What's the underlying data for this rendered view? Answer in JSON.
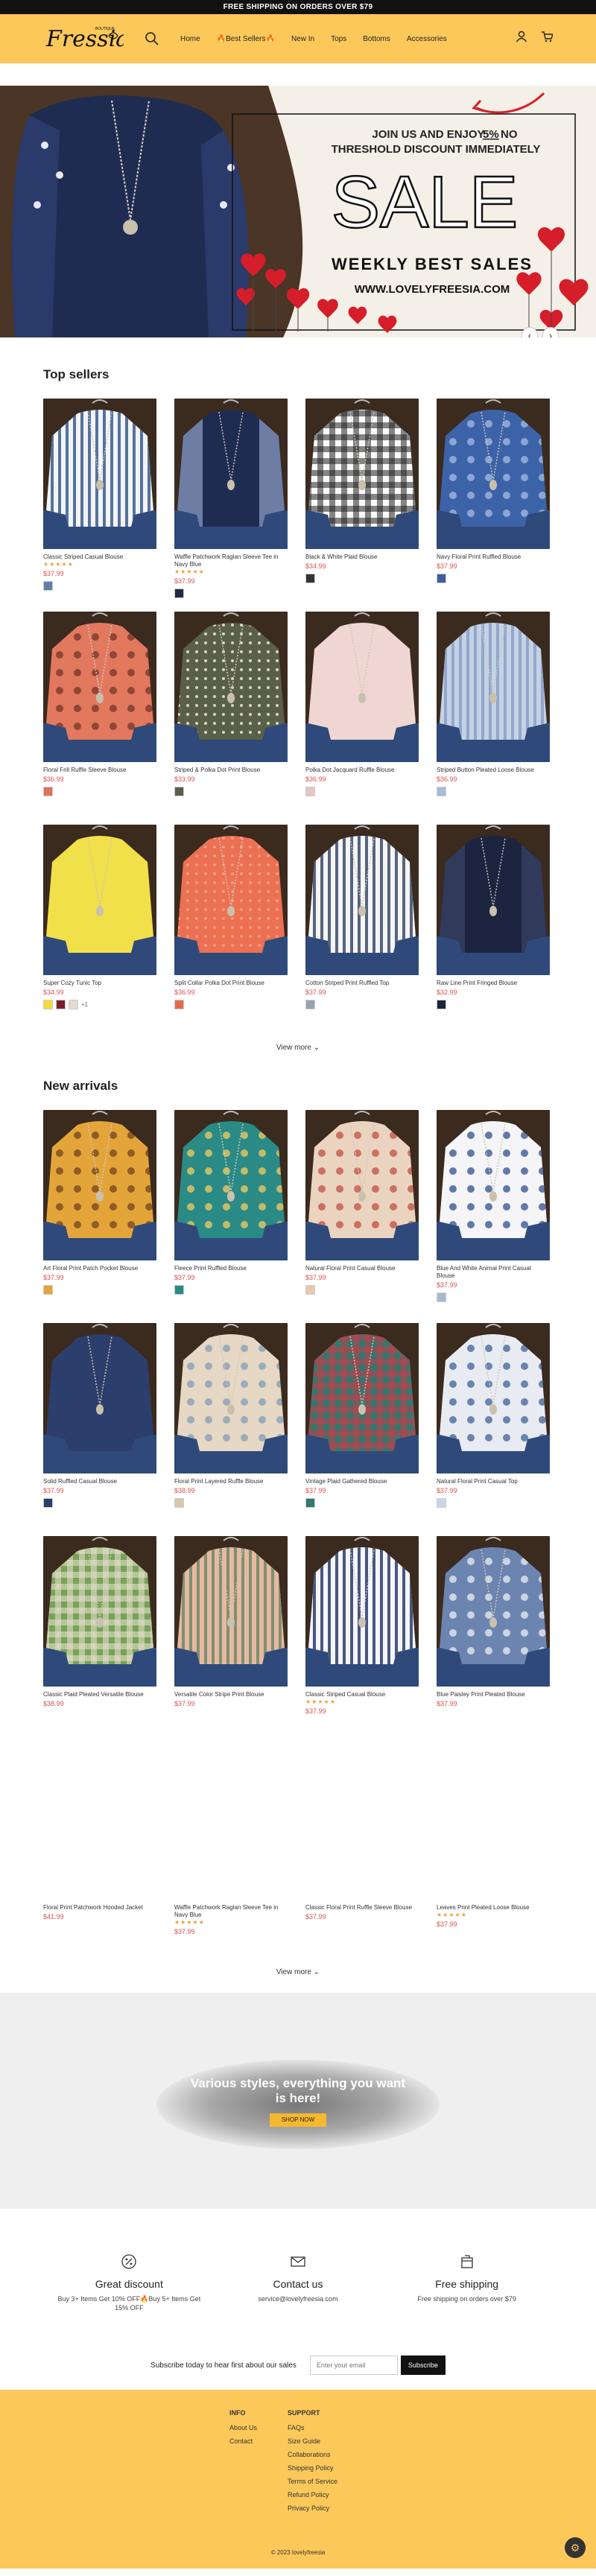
{
  "announcement": "FREE SHIPPING ON ORDERS OVER $79",
  "logo": {
    "text": "Fressia",
    "small": "BOUTIQUE"
  },
  "nav": [
    {
      "label": "Home"
    },
    {
      "label": "🔥Best Sellers🔥"
    },
    {
      "label": "New In"
    },
    {
      "label": "Tops"
    },
    {
      "label": "Bottoms"
    },
    {
      "label": "Accessories"
    }
  ],
  "hero": {
    "line1": "JOIN US AND ENJOY",
    "highlight": "5%",
    "line1b": "NO",
    "line2": "THRESHOLD DISCOUNT IMMEDIATELY",
    "sale": "SALE",
    "weekly": "WEEKLY BEST SALES",
    "url": "WWW.LOVELYFREESIA.COM",
    "prev": "‹",
    "next": "›"
  },
  "top_sellers": {
    "title": "Top sellers",
    "view_more": "View more",
    "products": [
      {
        "name": "Classic Striped Casual Blouse",
        "stars": "★★★★★",
        "price": "$37.99",
        "swatches": [
          "#5f7fa8"
        ],
        "more": ""
      },
      {
        "name": "Waffle Patchwork Raglan Sleeve Tee in Navy Blue",
        "stars": "★★★★★",
        "price": "$37.99",
        "swatches": [
          "#1e2a4a"
        ],
        "more": ""
      },
      {
        "name": "Black & White Plaid Blouse",
        "stars": "",
        "price": "$34.99",
        "swatches": [
          "#333"
        ],
        "more": ""
      },
      {
        "name": "Navy Floral Print Ruffled Blouse",
        "stars": "",
        "price": "$37.99",
        "swatches": [
          "#3d5f9c"
        ],
        "more": ""
      },
      {
        "name": "Floral Frill Ruffle Sleeve Blouse",
        "stars": "",
        "price": "$36.99",
        "swatches": [
          "#d9745a"
        ],
        "more": ""
      },
      {
        "name": "Striped & Polka Dot Print Blouse",
        "stars": "",
        "price": "$33.99",
        "swatches": [
          "#5a6048"
        ],
        "more": ""
      },
      {
        "name": "Polka Dot Jacquard Ruffle Blouse",
        "stars": "",
        "price": "$36.99",
        "swatches": [
          "#e6c6c6"
        ],
        "more": ""
      },
      {
        "name": "Striped Button Pleated Loose Blouse",
        "stars": "",
        "price": "$36.99",
        "swatches": [
          "#a9bcd8"
        ],
        "more": ""
      },
      {
        "name": "Super Cozy Tunic Top",
        "stars": "",
        "price": "$34.99",
        "swatches": [
          "#f1dc3a",
          "#7a1f2a",
          "#e7d9cf"
        ],
        "more": "+1"
      },
      {
        "name": "Split Collar Polka Dot Print Blouse",
        "stars": "",
        "price": "$36.99",
        "swatches": [
          "#e6684e"
        ],
        "more": ""
      },
      {
        "name": "Cotton Striped Print Ruffled Top",
        "stars": "",
        "price": "$37.99",
        "swatches": [
          "#9aa3ad"
        ],
        "more": ""
      },
      {
        "name": "Raw Line Print Fringed Blouse",
        "stars": "",
        "price": "$32.99",
        "swatches": [
          "#1c2440"
        ],
        "more": ""
      }
    ]
  },
  "new_arrivals": {
    "title": "New arrivals",
    "view_more": "View more",
    "products": [
      {
        "name": "Art Floral Print Patch Pocket Blouse",
        "stars": "",
        "price": "$37.99",
        "swatches": [
          "#e3a53a"
        ],
        "more": ""
      },
      {
        "name": "Fleece Print Ruffled Blouse",
        "stars": "",
        "price": "$37.99",
        "swatches": [
          "#2a8a86"
        ],
        "more": ""
      },
      {
        "name": "Natural Floral Print Casual Blouse",
        "stars": "",
        "price": "$37.99",
        "swatches": [
          "#e8c8b0"
        ],
        "more": ""
      },
      {
        "name": "Blue And White Animal Print Casual Blouse",
        "stars": "",
        "price": "$37.99",
        "swatches": [
          "#aab9d3"
        ],
        "more": ""
      },
      {
        "name": "Solid Ruffled Casual Blouse",
        "stars": "",
        "price": "$37.99",
        "swatches": [
          "#2c3e6b"
        ],
        "more": ""
      },
      {
        "name": "Floral Print Layered Ruffle Blouse",
        "stars": "",
        "price": "$38.99",
        "swatches": [
          "#d8c8b0"
        ],
        "more": ""
      },
      {
        "name": "Vintage Plaid Gathered Blouse",
        "stars": "",
        "price": "$37.99",
        "swatches": [
          "#2f7a6c"
        ],
        "more": ""
      },
      {
        "name": "Natural Floral Print Casual Top",
        "stars": "",
        "price": "$37.99",
        "swatches": [
          "#c9d6e8"
        ],
        "more": ""
      },
      {
        "name": "Classic Plaid Pleated Versatile Blouse",
        "stars": "",
        "price": "$38.99",
        "swatches": [],
        "more": ""
      },
      {
        "name": "Versatile Color Stripe Print Blouse",
        "stars": "",
        "price": "$37.99",
        "swatches": [],
        "more": ""
      },
      {
        "name": "Classic Striped Casual Blouse",
        "stars": "★★★★★",
        "price": "$37.99",
        "swatches": [],
        "more": ""
      },
      {
        "name": "Blue Paisley Print Pleated Blouse",
        "stars": "",
        "price": "$37.99",
        "swatches": [],
        "more": ""
      },
      {
        "name": "Floral Print Patchwork Hooded Jacket",
        "stars": "",
        "price": "$41.99",
        "swatches": [],
        "more": ""
      },
      {
        "name": "Waffle Patchwork Raglan Sleeve Tee in Navy Blue",
        "stars": "★★★★★",
        "price": "$37.99",
        "swatches": [],
        "more": ""
      },
      {
        "name": "Classic Floral Print Ruffle Sleeve Blouse",
        "stars": "",
        "price": "$37.99",
        "swatches": [],
        "more": ""
      },
      {
        "name": "Leaves Print Pleated Loose Blouse",
        "stars": "★★★★★",
        "price": "$37.99",
        "swatches": [],
        "more": ""
      }
    ]
  },
  "promo": {
    "text": "Various styles, everything you want is here!",
    "button": "SHOP NOW"
  },
  "features": [
    {
      "title": "Great discount",
      "text": "Buy 3+ Items Get 10% OFF🔥Buy 5+ Items Get 15% OFF"
    },
    {
      "title": "Contact us",
      "text": "service@lovelyfreesia.com"
    },
    {
      "title": "Free shipping",
      "text": "Free shipping on orders over $79"
    }
  ],
  "newsletter": {
    "label": "Subscribe today to hear first about our sales",
    "placeholder": "Enter your email",
    "button": "Subscribe"
  },
  "footer": {
    "info_title": "INFO",
    "info": [
      "About Us",
      "Contact"
    ],
    "support_title": "SUPPORT",
    "support": [
      "FAQs",
      "Size Guide",
      "Collaborations",
      "Shipping Policy",
      "Terms of Service",
      "Refund Policy",
      "Privacy Policy"
    ],
    "copyright": "© 2023 lovelyfreesia"
  },
  "colors": {
    "header": "#fcc85a",
    "price": "#d9534f",
    "accent_button": "#f5b82e"
  }
}
